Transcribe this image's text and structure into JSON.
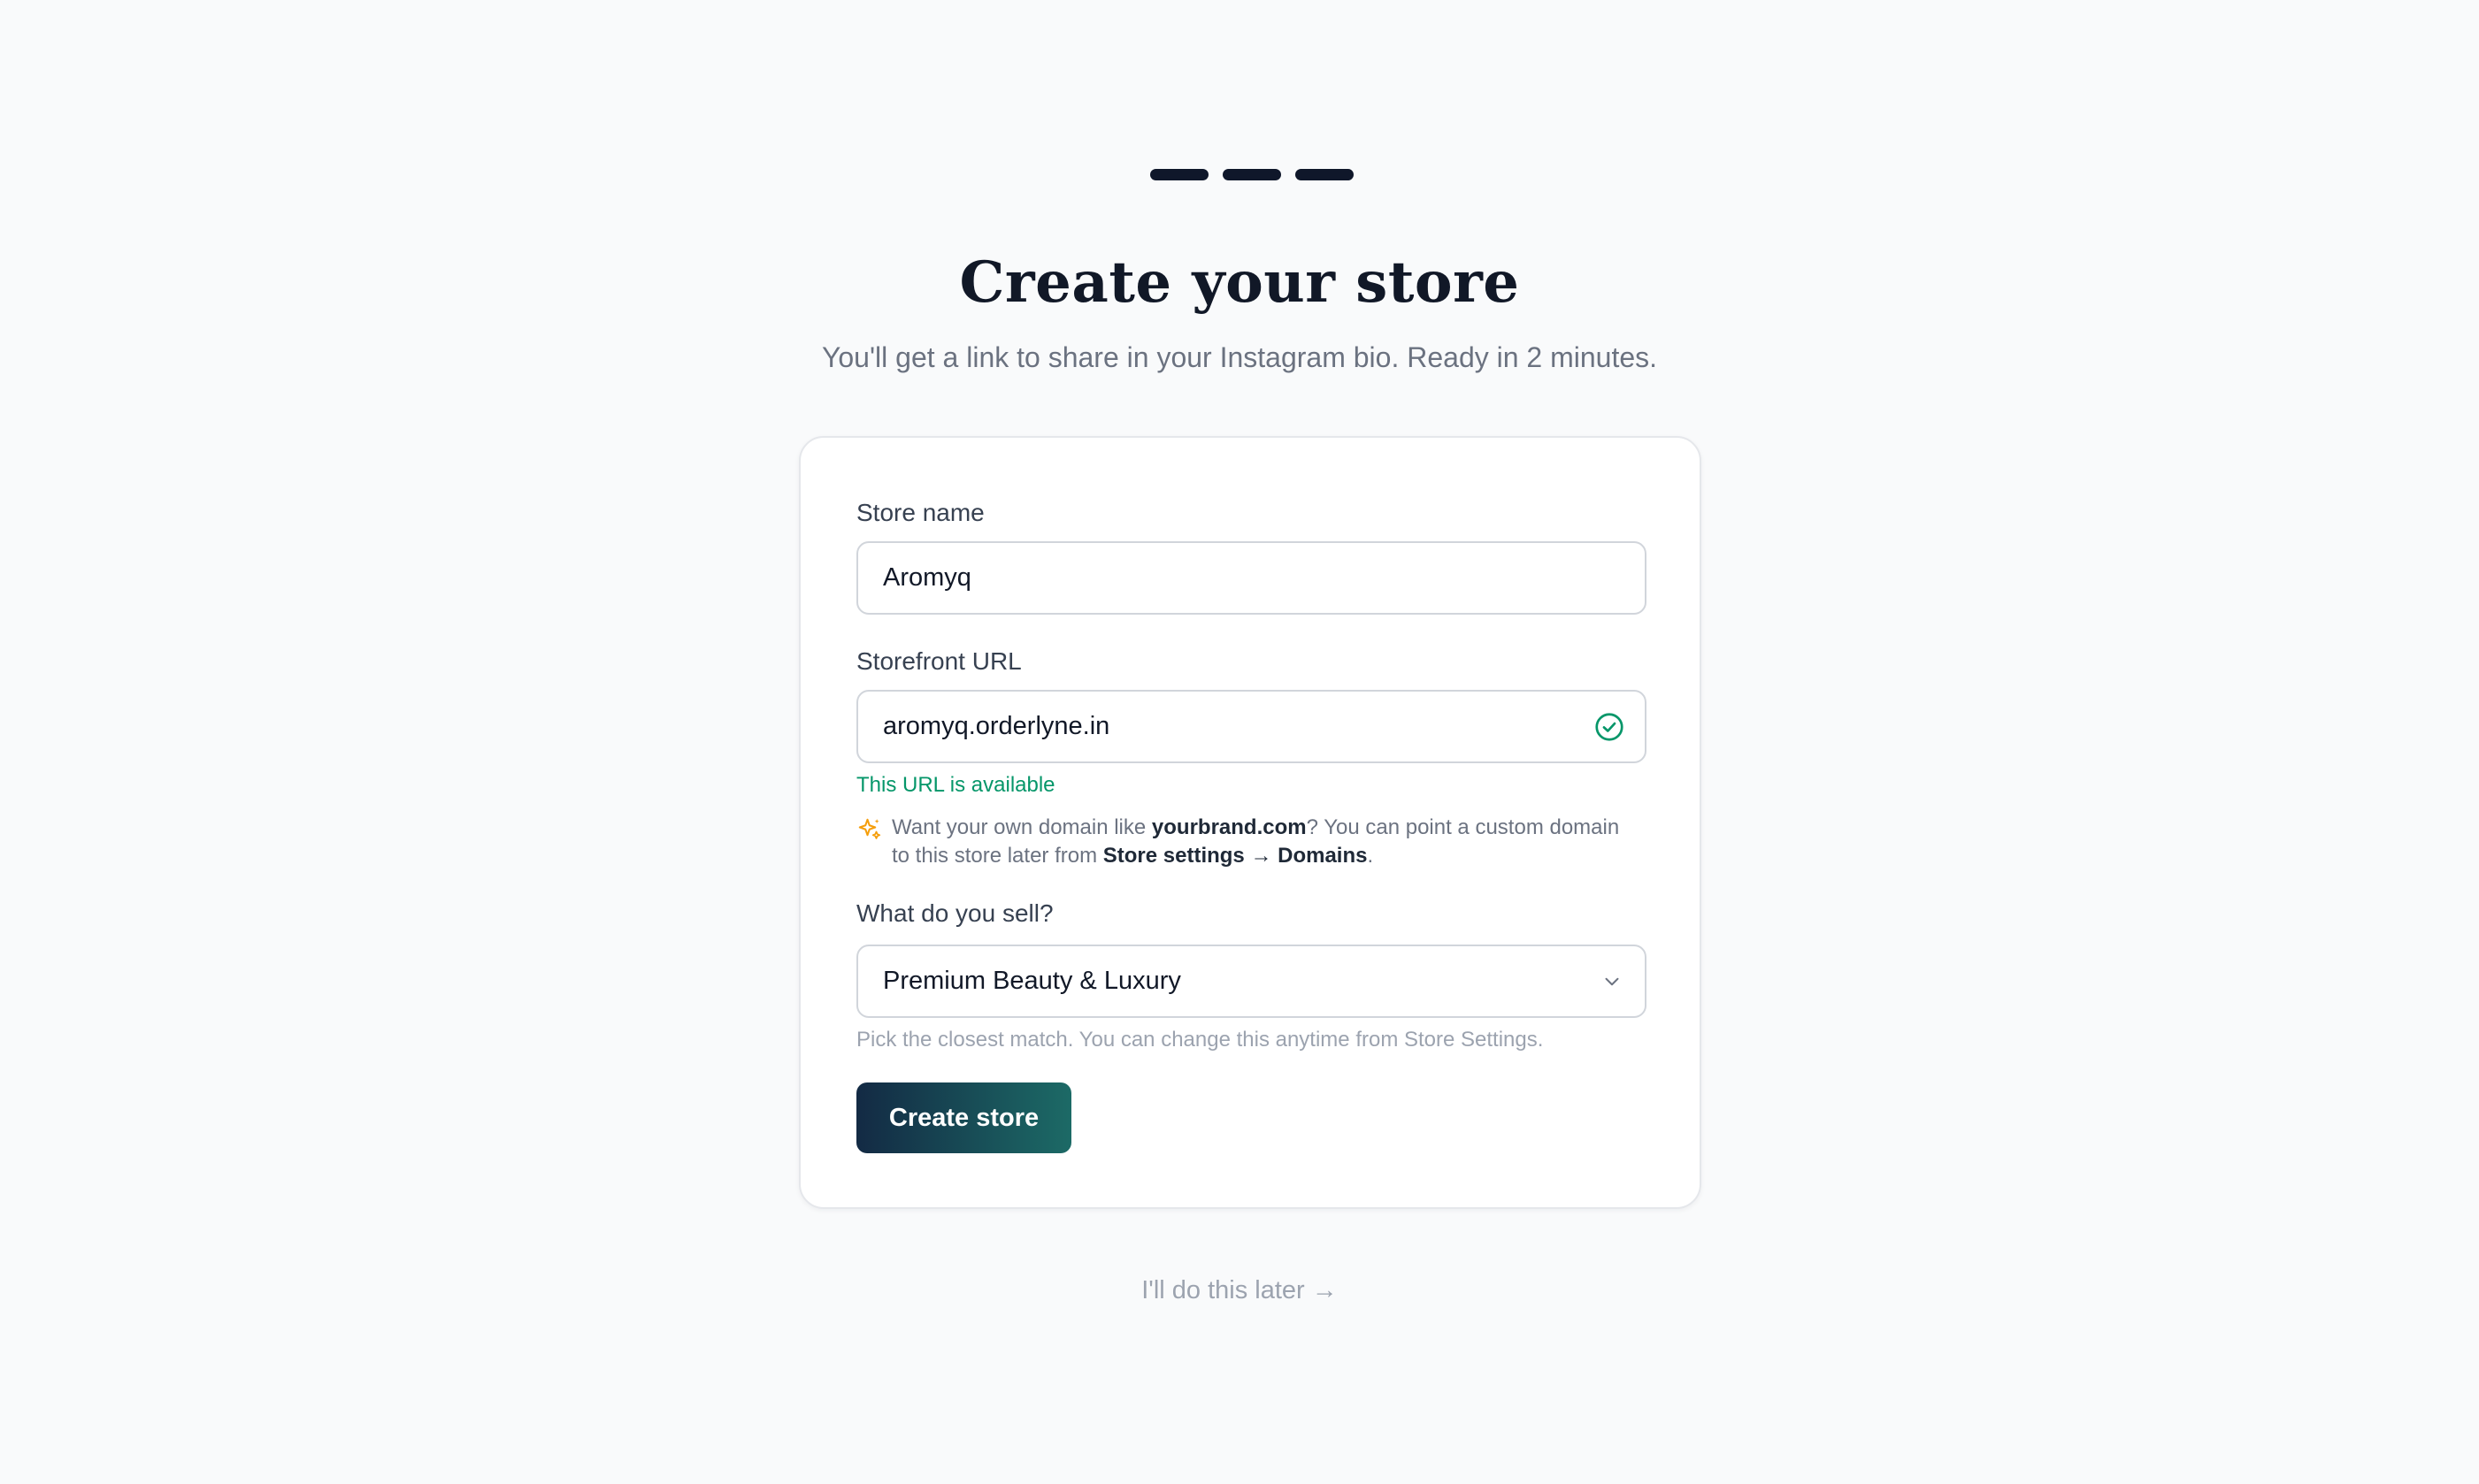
{
  "progress": {
    "steps": 3,
    "color": "#0f172a"
  },
  "header": {
    "title": "Create your store",
    "subtitle": "You'll get a link to share in your Instagram bio. Ready in 2 minutes."
  },
  "form": {
    "store_name": {
      "label": "Store name",
      "value": "Aromyq"
    },
    "storefront_url": {
      "label": "Storefront URL",
      "value": "aromyq.orderlyne.in",
      "status": "This URL is available",
      "status_icon": "check-circle-icon",
      "status_color": "#059669"
    },
    "domain_hint": {
      "icon": "sparkle-icon",
      "icon_color": "#f59e0b",
      "part1": "Want your own domain like ",
      "example_domain": "yourbrand.com",
      "part2": "? You can point a custom domain to this store later from ",
      "settings_path": "Store settings → Domains",
      "part3": "."
    },
    "category": {
      "label": "What do you sell?",
      "selected": "Premium Beauty & Luxury",
      "help": "Pick the closest match. You can change this anytime from Store Settings."
    },
    "submit_label": "Create store"
  },
  "skip_link": "I'll do this later →",
  "colors": {
    "background": "#f9fafb",
    "button_gradient_start": "#132a44",
    "button_gradient_end": "#1c6a66"
  }
}
